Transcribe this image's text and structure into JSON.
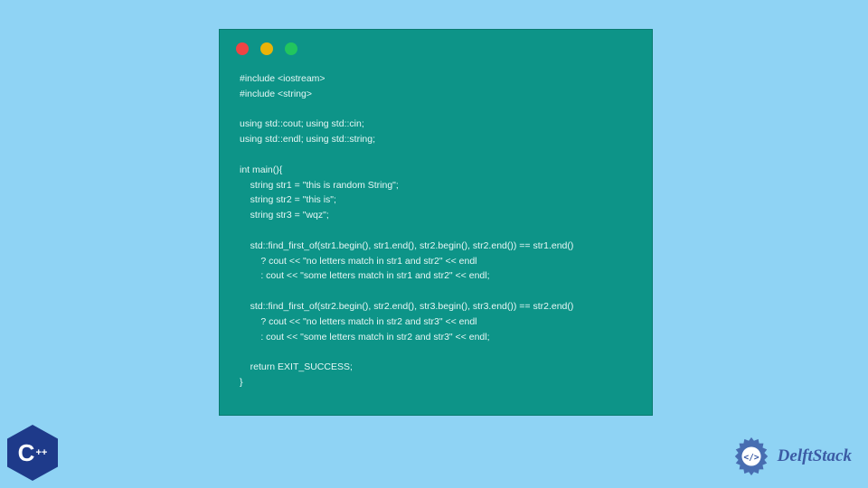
{
  "code": {
    "lines": [
      "#include <iostream>",
      "#include <string>",
      "",
      "using std::cout; using std::cin;",
      "using std::endl; using std::string;",
      "",
      "int main(){",
      "    string str1 = \"this is random String\";",
      "    string str2 = \"this is\";",
      "    string str3 = \"wqz\";",
      "",
      "    std::find_first_of(str1.begin(), str1.end(), str2.begin(), str2.end()) == str1.end()",
      "        ? cout << \"no letters match in str1 and str2\" << endl",
      "        : cout << \"some letters match in str1 and str2\" << endl;",
      "",
      "    std::find_first_of(str2.begin(), str2.end(), str3.begin(), str3.end()) == str2.end()",
      "        ? cout << \"no letters match in str2 and str3\" << endl",
      "        : cout << \"some letters match in str2 and str3\" << endl;",
      "",
      "    return EXIT_SUCCESS;",
      "}"
    ]
  },
  "badges": {
    "cpp": {
      "letter": "C",
      "plus": "++"
    },
    "brand": "DelftStack"
  },
  "colors": {
    "bg": "#8fd3f4",
    "window": "#0d9488",
    "dotRed": "#ef4444",
    "dotYellow": "#eab308",
    "dotGreen": "#22c55e",
    "cppBadge": "#1e3a8a",
    "brandText": "#3b5ba5"
  }
}
